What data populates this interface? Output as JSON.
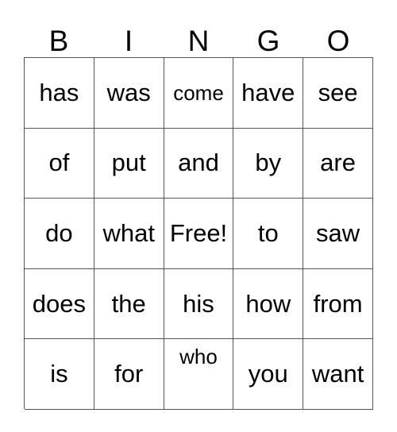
{
  "card": {
    "title_letters": [
      "B",
      "I",
      "N",
      "G",
      "O"
    ],
    "free_space_label": "Free!",
    "colors": {
      "background": "#ffffff",
      "text": "#000000",
      "grid_line": "#555555"
    },
    "grid": {
      "columns": 5,
      "rows": 5,
      "cells": [
        [
          {
            "text": "has",
            "size": "normal",
            "align": "center"
          },
          {
            "text": "was",
            "size": "normal",
            "align": "center"
          },
          {
            "text": "come",
            "size": "small",
            "align": "center"
          },
          {
            "text": "have",
            "size": "normal",
            "align": "center"
          },
          {
            "text": "see",
            "size": "normal",
            "align": "center"
          }
        ],
        [
          {
            "text": "of",
            "size": "normal",
            "align": "center"
          },
          {
            "text": "put",
            "size": "normal",
            "align": "center"
          },
          {
            "text": "and",
            "size": "normal",
            "align": "center"
          },
          {
            "text": "by",
            "size": "normal",
            "align": "center"
          },
          {
            "text": "are",
            "size": "normal",
            "align": "center"
          }
        ],
        [
          {
            "text": "do",
            "size": "normal",
            "align": "center"
          },
          {
            "text": "what",
            "size": "normal",
            "align": "center"
          },
          {
            "text": "Free!",
            "size": "normal",
            "align": "center",
            "free": true
          },
          {
            "text": "to",
            "size": "normal",
            "align": "center"
          },
          {
            "text": "saw",
            "size": "normal",
            "align": "center"
          }
        ],
        [
          {
            "text": "does",
            "size": "normal",
            "align": "center"
          },
          {
            "text": "the",
            "size": "normal",
            "align": "center"
          },
          {
            "text": "his",
            "size": "normal",
            "align": "center"
          },
          {
            "text": "how",
            "size": "normal",
            "align": "center"
          },
          {
            "text": "from",
            "size": "normal",
            "align": "center"
          }
        ],
        [
          {
            "text": "is",
            "size": "normal",
            "align": "center"
          },
          {
            "text": "for",
            "size": "normal",
            "align": "center"
          },
          {
            "text": "who",
            "size": "small",
            "align": "top"
          },
          {
            "text": "you",
            "size": "normal",
            "align": "center"
          },
          {
            "text": "want",
            "size": "normal",
            "align": "center"
          }
        ]
      ]
    }
  }
}
